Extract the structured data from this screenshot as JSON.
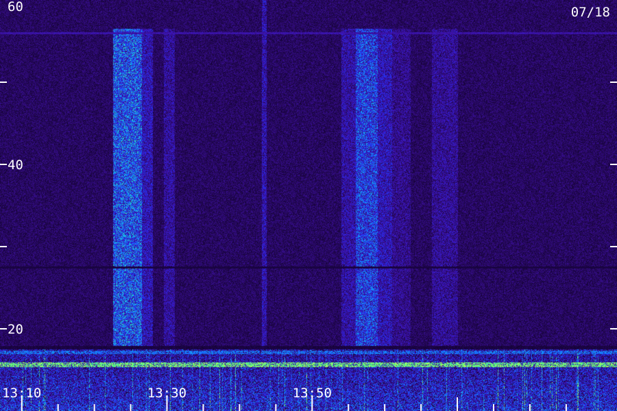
{
  "date_label": "07/18",
  "chart_data": {
    "type": "heatmap",
    "title": "",
    "xlabel": "",
    "ylabel": "",
    "ylim": [
      10,
      60
    ],
    "xlim_minutes": [
      13.07,
      13.92
    ],
    "y_tick_labels": [
      {
        "value": 60,
        "text": "60"
      },
      {
        "value": 40,
        "text": "40"
      },
      {
        "value": 20,
        "text": "20"
      }
    ],
    "y_ticks": [
      60,
      55,
      50,
      45,
      40,
      35,
      30,
      25,
      20
    ],
    "x_tick_labels": [
      {
        "value": 13.1,
        "text": "13:10"
      },
      {
        "value": 13.3,
        "text": "13:30"
      },
      {
        "value": 13.5,
        "text": "13:50"
      }
    ],
    "x_ticks": [
      13.1,
      13.15,
      13.2,
      13.25,
      13.3,
      13.35,
      13.4,
      13.45,
      13.5,
      13.55,
      13.6,
      13.65,
      13.7,
      13.75,
      13.8,
      13.85
    ],
    "background_level": 0.2,
    "horizontal_lines": [
      {
        "y": 56.0,
        "level": 0.32
      },
      {
        "y": 27.5,
        "level": 0.1
      }
    ],
    "vertical_bands": [
      {
        "x_start": 13.225,
        "x_end": 13.265,
        "y_min": 17.2,
        "y_max": 56.5,
        "level": 0.62
      },
      {
        "x_start": 13.265,
        "x_end": 13.28,
        "y_min": 17.2,
        "y_max": 56.5,
        "level": 0.4
      },
      {
        "x_start": 13.295,
        "x_end": 13.31,
        "y_min": 17.2,
        "y_max": 56.5,
        "level": 0.34
      },
      {
        "x_start": 13.43,
        "x_end": 13.437,
        "y_min": 17.2,
        "y_max": 60,
        "level": 0.38
      },
      {
        "x_start": 13.54,
        "x_end": 13.56,
        "y_min": 17.2,
        "y_max": 56.5,
        "level": 0.36
      },
      {
        "x_start": 13.56,
        "x_end": 13.59,
        "y_min": 17.2,
        "y_max": 56.5,
        "level": 0.56
      },
      {
        "x_start": 13.59,
        "x_end": 13.61,
        "y_min": 17.2,
        "y_max": 56.5,
        "level": 0.4
      },
      {
        "x_start": 13.6,
        "x_end": 13.635,
        "y_min": 17.2,
        "y_max": 56.5,
        "level": 0.3
      },
      {
        "x_start": 13.665,
        "x_end": 13.7,
        "y_min": 17.2,
        "y_max": 56.5,
        "level": 0.32
      }
    ],
    "low_frequency_noise": {
      "y_min": 10,
      "y_max": 17.5,
      "edge_y": 17.2,
      "level": 0.78
    }
  }
}
